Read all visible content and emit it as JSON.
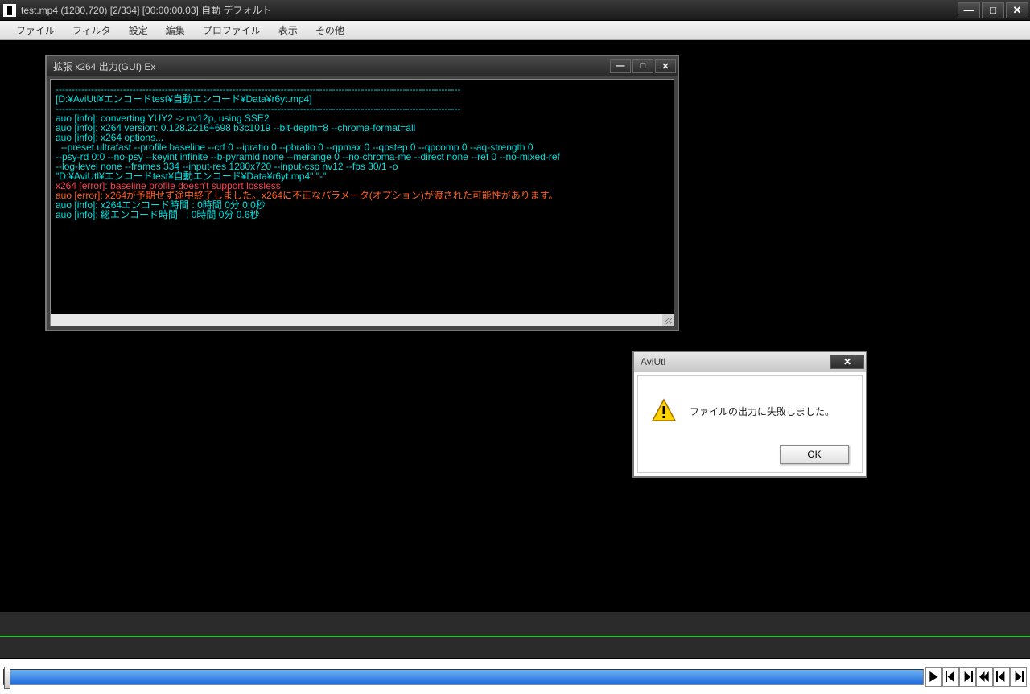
{
  "main_window": {
    "title": "test.mp4 (1280,720)  [2/334] [00:00:00.03]  自動  デフォルト",
    "menu": [
      "ファイル",
      "フィルタ",
      "設定",
      "編集",
      "プロファイル",
      "表示",
      "その他"
    ]
  },
  "console_window": {
    "title": "拡張 x264 出力(GUI) Ex",
    "lines_dash": "------------------------------------------------------------------------------------------------------------------------------",
    "line_path": "[D:¥AviUtl¥エンコードtest¥自動エンコード¥Data¥r6yt.mp4]",
    "line_info1": "auo [info]: converting YUY2 -> nv12p, using SSE2",
    "line_info2": "auo [info]: x264 version: 0.128.2216+698 b3c1019 --bit-depth=8 --chroma-format=all",
    "line_info3": "auo [info]: x264 options...",
    "line_opts1": "  --preset ultrafast --profile baseline --crf 0 --ipratio 0 --pbratio 0 --qpmax 0 --qpstep 0 --qpcomp 0 --aq-strength 0",
    "line_opts2": "--psy-rd 0:0 --no-psy --keyint infinite --b-pyramid none --merange 0 --no-chroma-me --direct none --ref 0 --no-mixed-ref",
    "line_opts3": "--log-level none --frames 334 --input-res 1280x720 --input-csp nv12 --fps 30/1 -o",
    "line_opts4": "\"D:¥AviUtl¥エンコードtest¥自動エンコード¥Data¥r6yt.mp4\" \"-\"",
    "line_err1": "x264 [error]: baseline profile doesn't support lossless",
    "line_err2": "auo [error]: x264が予期せず途中終了しました。x264に不正なパラメータ(オプション)が渡された可能性があります。",
    "line_time1": "auo [info]: x264エンコード時間 : 0時間 0分 0.0秒",
    "line_time2": "auo [info]: 総エンコード時間   : 0時間 0分 0.6秒"
  },
  "dialog": {
    "title": "AviUtl",
    "message": "ファイルの出力に失敗しました。",
    "ok_label": "OK"
  },
  "colors": {
    "console_cyan": "#00e0e0",
    "console_red": "#ff4050",
    "console_orange": "#ff6020",
    "timeline_green": "#00e000",
    "progress_blue": "#1e69de"
  }
}
